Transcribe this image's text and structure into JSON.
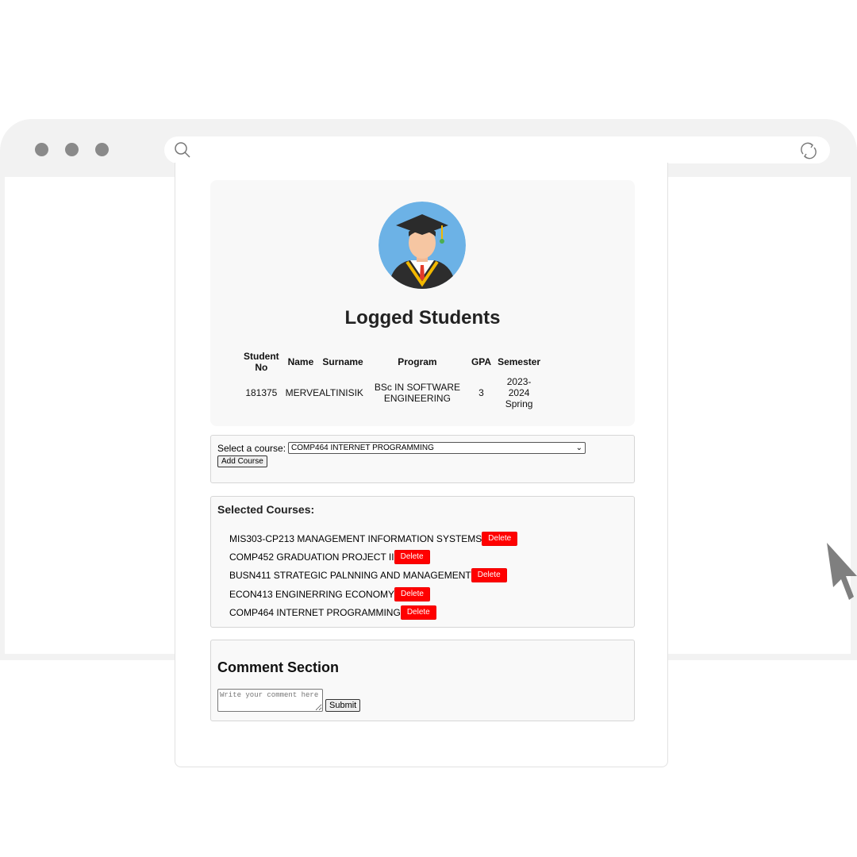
{
  "browser": {
    "address_placeholder": "",
    "icons": [
      "search-icon",
      "reload-icon"
    ]
  },
  "profile": {
    "avatar_icon": "graduate-avatar",
    "title": "Logged Students",
    "table": {
      "headers": [
        "Student No",
        "Name",
        "Surname",
        "Program",
        "GPA",
        "Semester"
      ],
      "rows": [
        [
          "181375",
          "MERVE",
          "ALTINISIK",
          "BSc IN SOFTWARE ENGINEERING",
          "3",
          "2023-2024 Spring"
        ]
      ]
    }
  },
  "course_select": {
    "label": "Select a course:",
    "selected": "COMP464 INTERNET PROGRAMMING",
    "add_label": "Add Course"
  },
  "selected_courses": {
    "heading": "Selected Courses:",
    "delete_label": "Delete",
    "items": [
      "MIS303-CP213 MANAGEMENT INFORMATION SYSTEMS",
      "COMP452 GRADUATION PROJECT II",
      "BUSN411 STRATEGIC PALNNING AND MANAGEMENT",
      "ECON413 ENGINERRING ECONOMY",
      "COMP464 INTERNET PROGRAMMING"
    ]
  },
  "comments": {
    "heading": "Comment Section",
    "placeholder": "Write your comment here",
    "submit_label": "Submit"
  },
  "colors": {
    "frame": "#f2f2f2",
    "delete": "#ff0000",
    "panel": "#f8f8f8",
    "cursor": "#808080"
  }
}
